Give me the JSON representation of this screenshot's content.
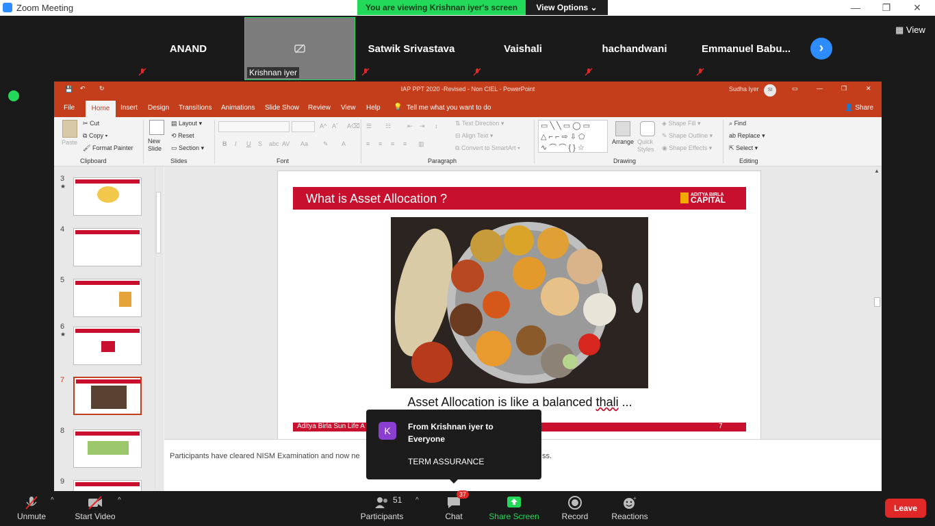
{
  "zoom": {
    "window_title": "Zoom Meeting",
    "viewing_banner": "You are viewing Krishnan iyer's screen",
    "view_options": "View Options",
    "view_button": "View"
  },
  "participants": [
    {
      "name": "ANAND"
    },
    {
      "name": "Krishnan iyer"
    },
    {
      "name": "Satwik Srivastava"
    },
    {
      "name": "Vaishali"
    },
    {
      "name": "hachandwani"
    },
    {
      "name": "Emmanuel  Babu..."
    }
  ],
  "ppt": {
    "window_title": "IAP PPT 2020 -Revised - Non CIEL  -  PowerPoint",
    "user": "Sudha Iyer",
    "avatar": "SI",
    "tabs": [
      "File",
      "Home",
      "Insert",
      "Design",
      "Transitions",
      "Animations",
      "Slide Show",
      "Review",
      "View",
      "Help"
    ],
    "tell_me": "Tell me what you want to do",
    "share": "Share",
    "ribbon": {
      "paste": "Paste",
      "cut": "Cut",
      "copy": "Copy",
      "format_painter": "Format Painter",
      "clipboard": "Clipboard",
      "new_slide": "New Slide",
      "layout": "Layout",
      "reset": "Reset",
      "section": "Section",
      "slides": "Slides",
      "font": "Font",
      "text_direction": "Text Direction",
      "align_text": "Align Text",
      "convert_smartart": "Convert to SmartArt",
      "paragraph": "Paragraph",
      "arrange": "Arrange",
      "quick_styles": "Quick Styles",
      "shape_fill": "Shape Fill",
      "shape_outline": "Shape Outline",
      "shape_effects": "Shape Effects",
      "drawing": "Drawing",
      "find": "Find",
      "replace": "Replace",
      "select": "Select",
      "editing": "Editing"
    },
    "thumbnails": [
      {
        "num": "3",
        "star": "★"
      },
      {
        "num": "4",
        "star": ""
      },
      {
        "num": "5",
        "star": ""
      },
      {
        "num": "6",
        "star": "★"
      },
      {
        "num": "7",
        "star": ""
      },
      {
        "num": "8",
        "star": ""
      },
      {
        "num": "9",
        "star": ""
      }
    ],
    "slide": {
      "title": "What is Asset Allocation ?",
      "logo_line1": "ADITYA BIRLA",
      "logo_line2": "CAPITAL",
      "caption_prefix": "Asset Allocation is like a balanced ",
      "caption_word": "thali",
      "caption_suffix": " ...",
      "footer": "Aditya Birla Sun Life A",
      "number": "7"
    },
    "notes_start": "Participants have cleared NISM Examination and now ne",
    "notes_end": "ss."
  },
  "chat_popup": {
    "avatar": "K",
    "from": "From Krishnan iyer to Everyone",
    "message": "TERM ASSURANCE"
  },
  "toolbar": {
    "unmute": "Unmute",
    "start_video": "Start Video",
    "participants": "Participants",
    "participants_count": "51",
    "chat": "Chat",
    "chat_badge": "37",
    "share_screen": "Share Screen",
    "record": "Record",
    "reactions": "Reactions",
    "leave": "Leave"
  },
  "colors": {
    "zoom_green": "#23d959",
    "zoom_blue": "#2d8cff",
    "ppt_accent": "#c43e1c",
    "slide_red": "#c8102e",
    "leave_red": "#e02828"
  }
}
